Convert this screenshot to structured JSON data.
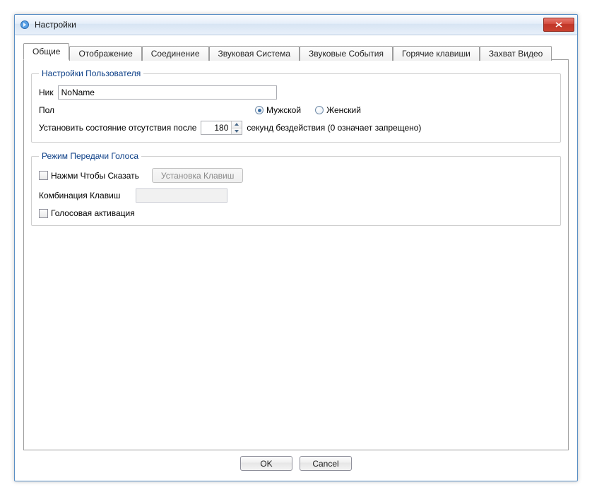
{
  "window": {
    "title": "Настройки"
  },
  "tabs": [
    {
      "label": "Общие",
      "active": true
    },
    {
      "label": "Отображение",
      "active": false
    },
    {
      "label": "Соединение",
      "active": false
    },
    {
      "label": "Звуковая Система",
      "active": false
    },
    {
      "label": "Звуковые События",
      "active": false
    },
    {
      "label": "Горячие клавиши",
      "active": false
    },
    {
      "label": "Захват Видео",
      "active": false
    }
  ],
  "user_settings": {
    "group_title": "Настройки Пользователя",
    "nick_label": "Ник",
    "nick_value": "NoName",
    "gender_label": "Пол",
    "gender_male": "Мужской",
    "gender_female": "Женский",
    "gender_selected": "male",
    "away_prefix": "Установить состояние отсутствия после",
    "away_seconds": "180",
    "away_suffix": "секунд бездействия (0 означает запрещено)"
  },
  "voice_tx": {
    "group_title": "Режим Передачи Голоса",
    "ptt_label": "Нажми Чтобы Сказать",
    "ptt_checked": false,
    "setup_keys_button": "Установка Клавиш",
    "setup_keys_enabled": false,
    "key_combo_label": "Комбинация Клавиш",
    "key_combo_value": "",
    "voice_activation_label": "Голосовая активация",
    "voice_activation_checked": false
  },
  "footer": {
    "ok": "OK",
    "cancel": "Cancel"
  }
}
